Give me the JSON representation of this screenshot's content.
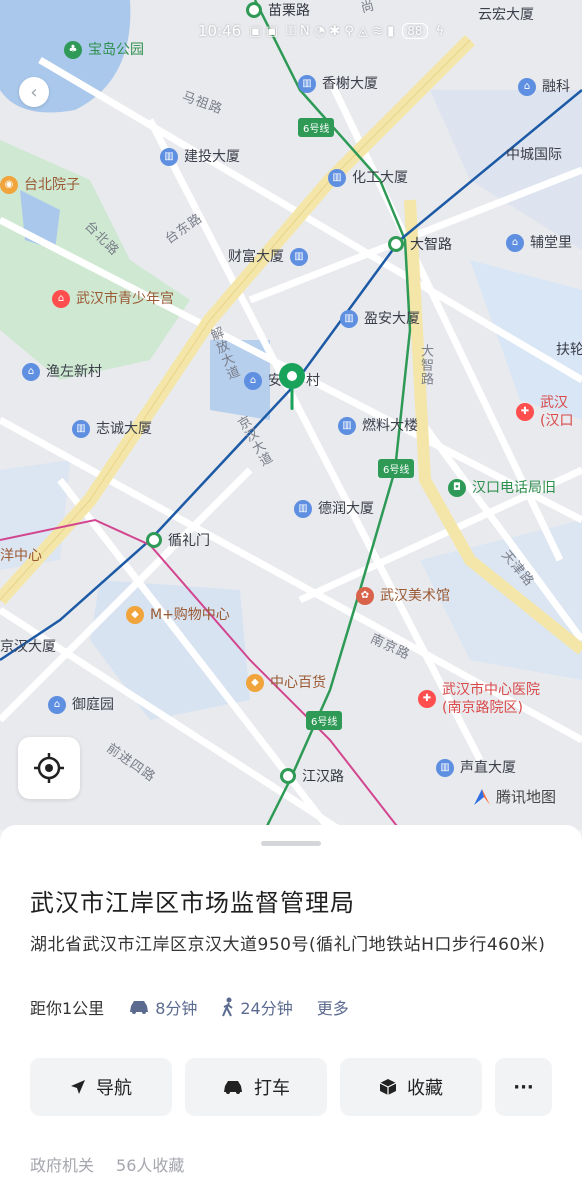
{
  "status_bar": {
    "time": "10:46",
    "battery": "88"
  },
  "map": {
    "pois": [
      {
        "name": "宝岛公园"
      },
      {
        "name": "香榭大厦"
      },
      {
        "name": "云宏大厦"
      },
      {
        "name": "融科"
      },
      {
        "name": "建投大厦"
      },
      {
        "name": "中城国际"
      },
      {
        "name": "台北院子"
      },
      {
        "name": "化工大厦"
      },
      {
        "name": "辅堂里"
      },
      {
        "name": "财富大厦"
      },
      {
        "name": "武汉市青少年宫"
      },
      {
        "name": "盈安大厦"
      },
      {
        "name": "扶轮"
      },
      {
        "name": "渔左新村"
      },
      {
        "name": "安"
      },
      {
        "name": "村"
      },
      {
        "name": "武汉"
      },
      {
        "name": "(汉口"
      },
      {
        "name": "志诚大厦"
      },
      {
        "name": "燃料大楼"
      },
      {
        "name": "汉口电话局旧"
      },
      {
        "name": "德润大厦"
      },
      {
        "name": "洋中心"
      },
      {
        "name": "M+购物中心"
      },
      {
        "name": "武汉美术馆"
      },
      {
        "name": "京汉大厦"
      },
      {
        "name": "中心百货"
      },
      {
        "name": "武汉市中心医院"
      },
      {
        "name": "(南京路院区)"
      },
      {
        "name": "御庭园"
      },
      {
        "name": "声直大厦"
      }
    ],
    "roads": [
      "马祖路",
      "台东路",
      "台北路",
      "解放大道",
      "京汉大道",
      "大智路",
      "天津路",
      "南京路",
      "前进四路",
      "尚"
    ],
    "stations": [
      "苗栗路",
      "大智路",
      "循礼门",
      "江汉路"
    ],
    "line_badge": "6号线",
    "brand": "腾讯地图"
  },
  "place": {
    "title": "武汉市江岸区市场监督管理局",
    "address": "湖北省武汉市江岸区京汉大道950号(循礼门地铁站H口步行460米)",
    "distance": "距你1公里",
    "drive_time": "8分钟",
    "walk_time": "24分钟",
    "more": "更多"
  },
  "actions": {
    "navigate": "导航",
    "taxi": "打车",
    "favorite": "收藏",
    "more": "···"
  },
  "tags": [
    "政府机关",
    "56人收藏"
  ],
  "colors": {
    "line6": "#2e9a56",
    "metro_blue": "#1c5aa6",
    "metro_pink": "#d2458f",
    "road_yellow": "#f4e6a8",
    "pin": "#18a25a"
  }
}
